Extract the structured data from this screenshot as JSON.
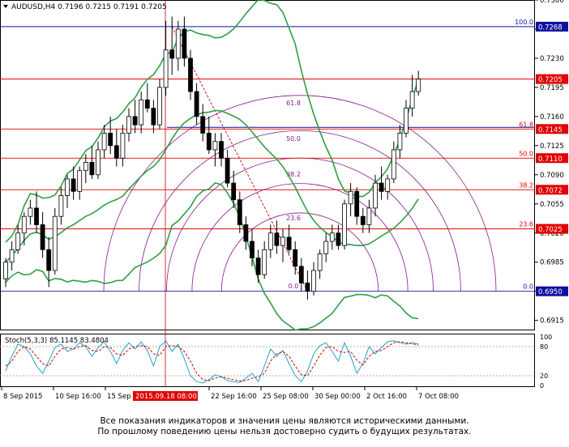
{
  "chart_data": {
    "type": "candlestick",
    "title": "AUDUSD,H4",
    "ohlc_header": "0.7196 0.7215 0.7191 0.7205",
    "ylim": [
      0.6903,
      0.73
    ],
    "y_ticks": [
      0.73,
      0.7265,
      0.723,
      0.7195,
      0.716,
      0.7125,
      0.709,
      0.7055,
      0.702,
      0.6985,
      0.695,
      0.6915
    ],
    "x_tick_labels": [
      "8 Sep 2015",
      "10 Sep 16:00",
      "15 Sep",
      "22 Sep 16:00",
      "25 Sep 08:00",
      "30 Sep 00:00",
      "2 Oct 16:00",
      "7 Oct 08:00"
    ],
    "highlight_x_label": "2015.09.18 08:00",
    "horizontal_levels": [
      {
        "price": 0.7268,
        "label": "0.7268",
        "fib": "100.0",
        "color": "#1010a0"
      },
      {
        "price": 0.7205,
        "label": "0.7205",
        "fib": "",
        "color": "#e00000"
      },
      {
        "price": 0.7145,
        "label": "0.7145",
        "fib": "61.8",
        "color": "#e00000"
      },
      {
        "price": 0.711,
        "label": "0.7110",
        "fib": "50.0",
        "color": "#e00000"
      },
      {
        "price": 0.7072,
        "label": "0.7072",
        "fib": "38.2",
        "color": "#e00000"
      },
      {
        "price": 0.7025,
        "label": "0.7025",
        "fib": "23.6",
        "color": "#e00000"
      },
      {
        "price": 0.695,
        "label": "0.6950",
        "fib": "0.0",
        "color": "#1010a0"
      }
    ],
    "fib_arc_labels": [
      "61.8",
      "50.0",
      "38.2",
      "23.6",
      "0.0"
    ],
    "candles": [
      [
        0.6965,
        0.699,
        0.6955,
        0.6985
      ],
      [
        0.6985,
        0.701,
        0.6975,
        0.7
      ],
      [
        0.7,
        0.703,
        0.6995,
        0.702
      ],
      [
        0.702,
        0.7045,
        0.7005,
        0.704
      ],
      [
        0.704,
        0.706,
        0.703,
        0.705
      ],
      [
        0.705,
        0.707,
        0.702,
        0.703
      ],
      [
        0.703,
        0.7045,
        0.699,
        0.7
      ],
      [
        0.7,
        0.7015,
        0.6955,
        0.6975
      ],
      [
        0.6975,
        0.705,
        0.697,
        0.704
      ],
      [
        0.704,
        0.7075,
        0.703,
        0.7065
      ],
      [
        0.7065,
        0.709,
        0.705,
        0.7085
      ],
      [
        0.7085,
        0.71,
        0.706,
        0.707
      ],
      [
        0.707,
        0.71,
        0.706,
        0.7095
      ],
      [
        0.7095,
        0.7115,
        0.708,
        0.7105
      ],
      [
        0.7105,
        0.7125,
        0.7085,
        0.709
      ],
      [
        0.709,
        0.713,
        0.7085,
        0.712
      ],
      [
        0.712,
        0.715,
        0.711,
        0.714
      ],
      [
        0.714,
        0.716,
        0.7115,
        0.7125
      ],
      [
        0.7125,
        0.7145,
        0.71,
        0.711
      ],
      [
        0.711,
        0.715,
        0.71,
        0.714
      ],
      [
        0.714,
        0.717,
        0.713,
        0.716
      ],
      [
        0.716,
        0.718,
        0.714,
        0.715
      ],
      [
        0.715,
        0.719,
        0.714,
        0.718
      ],
      [
        0.718,
        0.72,
        0.7165,
        0.717
      ],
      [
        0.717,
        0.718,
        0.714,
        0.715
      ],
      [
        0.715,
        0.7205,
        0.7145,
        0.7195
      ],
      [
        0.7195,
        0.7275,
        0.7185,
        0.724
      ],
      [
        0.724,
        0.728,
        0.721,
        0.723
      ],
      [
        0.723,
        0.7275,
        0.7215,
        0.7265
      ],
      [
        0.7265,
        0.728,
        0.722,
        0.723
      ],
      [
        0.723,
        0.724,
        0.718,
        0.719
      ],
      [
        0.719,
        0.72,
        0.715,
        0.716
      ],
      [
        0.716,
        0.7175,
        0.713,
        0.714
      ],
      [
        0.714,
        0.716,
        0.7115,
        0.712
      ],
      [
        0.712,
        0.714,
        0.71,
        0.713
      ],
      [
        0.713,
        0.714,
        0.71,
        0.711
      ],
      [
        0.711,
        0.712,
        0.7075,
        0.708
      ],
      [
        0.708,
        0.7095,
        0.705,
        0.706
      ],
      [
        0.706,
        0.707,
        0.702,
        0.703
      ],
      [
        0.703,
        0.704,
        0.7,
        0.701
      ],
      [
        0.701,
        0.7025,
        0.698,
        0.699
      ],
      [
        0.699,
        0.7,
        0.696,
        0.697
      ],
      [
        0.697,
        0.701,
        0.6965,
        0.7
      ],
      [
        0.7,
        0.703,
        0.699,
        0.702
      ],
      [
        0.702,
        0.7035,
        0.6995,
        0.7005
      ],
      [
        0.7005,
        0.7025,
        0.6985,
        0.7015
      ],
      [
        0.7015,
        0.703,
        0.6995,
        0.7
      ],
      [
        0.7,
        0.701,
        0.697,
        0.698
      ],
      [
        0.698,
        0.699,
        0.695,
        0.696
      ],
      [
        0.696,
        0.6975,
        0.694,
        0.695
      ],
      [
        0.695,
        0.6985,
        0.6945,
        0.6975
      ],
      [
        0.6975,
        0.7,
        0.6965,
        0.6995
      ],
      [
        0.6995,
        0.702,
        0.6985,
        0.701
      ],
      [
        0.701,
        0.703,
        0.7,
        0.702
      ],
      [
        0.702,
        0.703,
        0.7,
        0.7005
      ],
      [
        0.7005,
        0.706,
        0.7,
        0.7055
      ],
      [
        0.7055,
        0.708,
        0.704,
        0.707
      ],
      [
        0.707,
        0.7075,
        0.703,
        0.704
      ],
      [
        0.704,
        0.705,
        0.702,
        0.703
      ],
      [
        0.703,
        0.706,
        0.702,
        0.705
      ],
      [
        0.705,
        0.709,
        0.704,
        0.708
      ],
      [
        0.708,
        0.71,
        0.706,
        0.707
      ],
      [
        0.707,
        0.709,
        0.706,
        0.7085
      ],
      [
        0.7085,
        0.713,
        0.708,
        0.712
      ],
      [
        0.712,
        0.715,
        0.711,
        0.714
      ],
      [
        0.714,
        0.718,
        0.7135,
        0.717
      ],
      [
        0.717,
        0.721,
        0.716,
        0.719
      ],
      [
        0.719,
        0.7215,
        0.7185,
        0.7205
      ]
    ],
    "stochastic": {
      "label": "Stoch(5,3,3) 85.1145 83.4804",
      "ylim": [
        0,
        100
      ],
      "ticks": [
        100,
        80,
        20,
        0
      ],
      "main": [
        30,
        60,
        85,
        80,
        65,
        40,
        25,
        50,
        78,
        85,
        70,
        75,
        88,
        80,
        60,
        78,
        90,
        70,
        45,
        72,
        88,
        75,
        90,
        72,
        40,
        80,
        92,
        70,
        85,
        55,
        20,
        8,
        5,
        12,
        22,
        18,
        10,
        8,
        6,
        15,
        25,
        8,
        40,
        75,
        60,
        72,
        45,
        20,
        8,
        30,
        65,
        82,
        88,
        70,
        50,
        88,
        60,
        25,
        45,
        80,
        65,
        78,
        90,
        92,
        88,
        85,
        88,
        85
      ],
      "signal": [
        40,
        50,
        70,
        80,
        75,
        60,
        45,
        40,
        60,
        75,
        78,
        75,
        80,
        82,
        72,
        70,
        80,
        78,
        65,
        62,
        75,
        80,
        82,
        80,
        65,
        62,
        80,
        82,
        80,
        70,
        50,
        25,
        12,
        10,
        15,
        18,
        15,
        12,
        9,
        10,
        15,
        18,
        25,
        50,
        65,
        70,
        60,
        40,
        22,
        20,
        40,
        62,
        78,
        80,
        70,
        68,
        70,
        52,
        42,
        60,
        70,
        72,
        80,
        88,
        90,
        88,
        86,
        83
      ]
    }
  },
  "disclaimer": {
    "line1": "Все показания индикаторов и значения цены являются историческими данными.",
    "line2": "По прошлому поведению цены нельзя достоверно судить о будущих результатах."
  }
}
